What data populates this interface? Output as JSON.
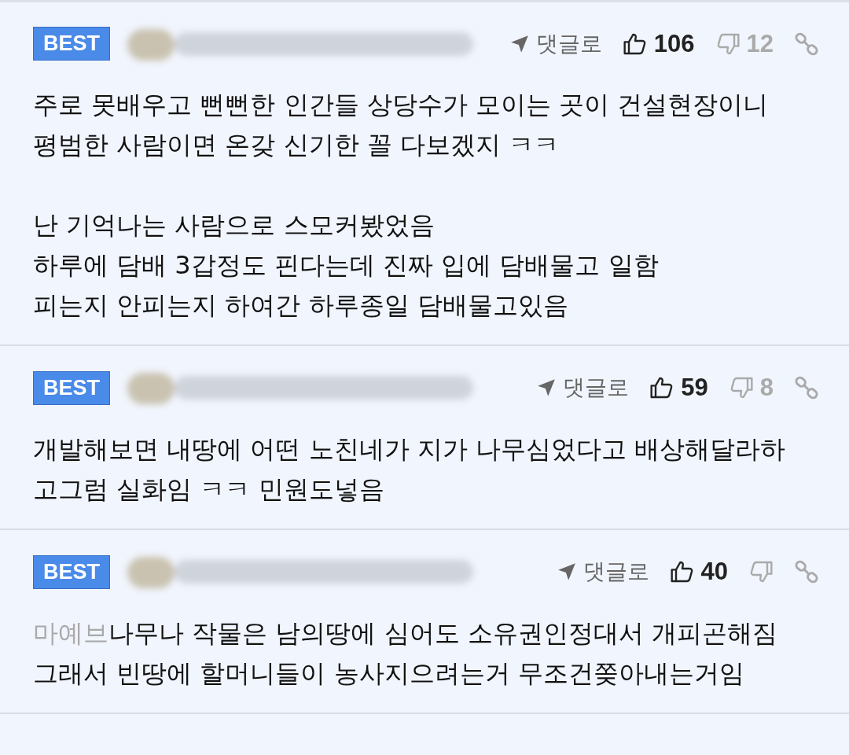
{
  "comments": [
    {
      "badge": "BEST",
      "reply_label": "댓글로",
      "likes": "106",
      "dislikes": "12",
      "text": "주로 못배우고 뻔뻔한 인간들 상당수가 모이는 곳이 건설현장이니\n평범한 사람이면 온갖 신기한 꼴 다보겠지 ㅋㅋ\n\n난 기억나는 사람으로 스모커봤었음\n하루에 담배 3갑정도 핀다는데 진짜 입에 담배물고 일함\n피는지 안피는지 하여간 하루종일 담배물고있음"
    },
    {
      "badge": "BEST",
      "reply_label": "댓글로",
      "likes": "59",
      "dislikes": "8",
      "text": "개발해보면 내땅에 어떤 노친네가 지가 나무심었다고 배상해달라하\n고그럼 실화임 ㅋㅋ 민원도넣음"
    },
    {
      "badge": "BEST",
      "reply_label": "댓글로",
      "likes": "40",
      "mention": "마예브",
      "text": "나무나 작물은 남의땅에 심어도 소유권인정대서 개피곤해짐\n그래서 빈땅에 할머니들이 농사지으려는거 무조건쫒아내는거임"
    }
  ]
}
